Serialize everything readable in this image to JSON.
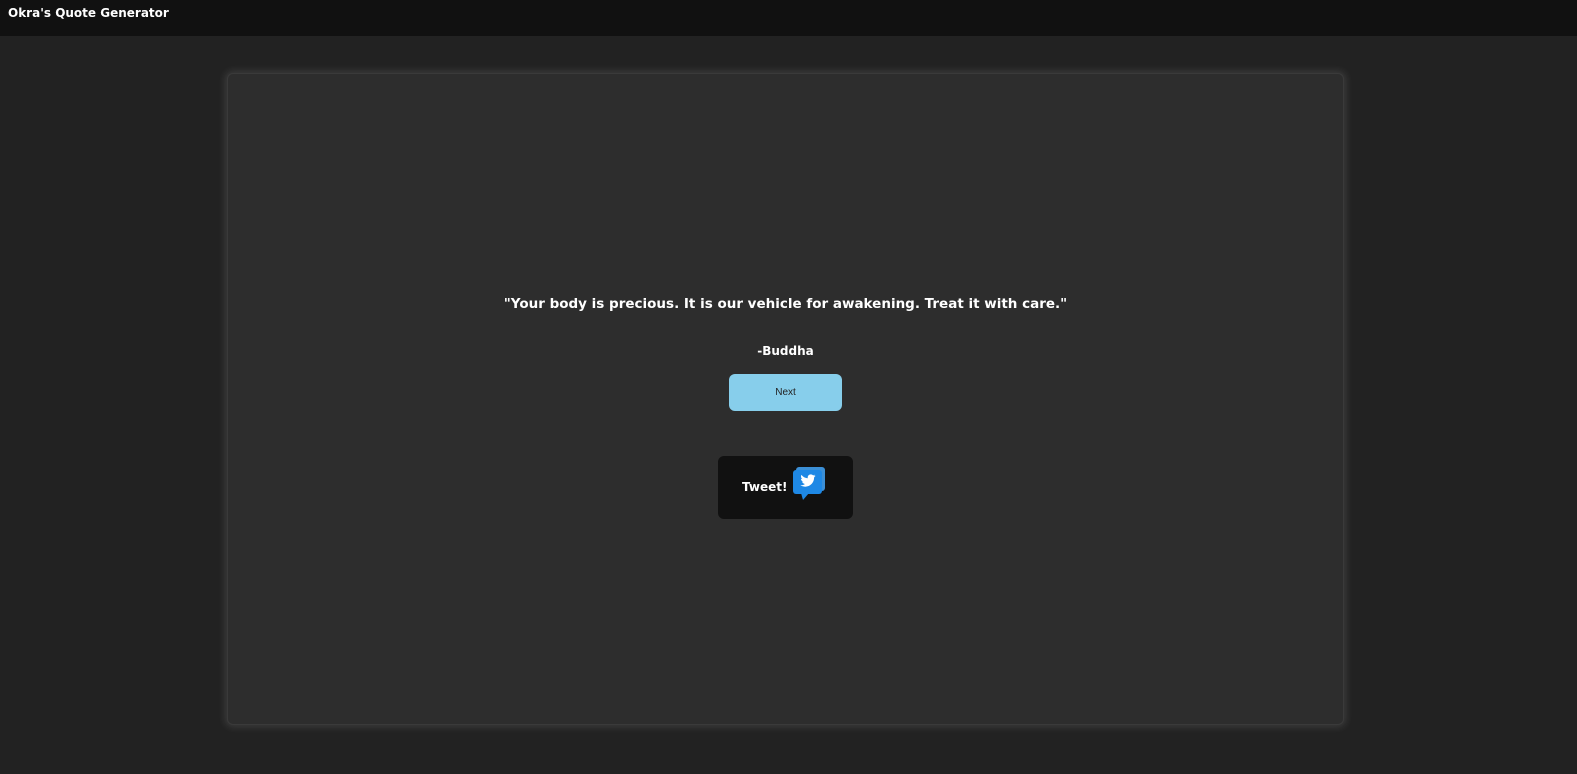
{
  "app": {
    "title": "Okra's Quote Generator"
  },
  "quote": {
    "text": "\"Your body is precious. It is our vehicle for awakening. Treat it with care.\"",
    "author": "-Buddha"
  },
  "actions": {
    "next_label": "Next",
    "tweet_label": "Tweet!",
    "tweet_icon": "twitter-bird-speech-bubble-icon"
  },
  "colors": {
    "background": "#222222",
    "header": "#111111",
    "card": "#2d2d2d",
    "next_button": "#87ceeb",
    "tweet_button": "#111111",
    "twitter_blue": "#1da1f2"
  }
}
